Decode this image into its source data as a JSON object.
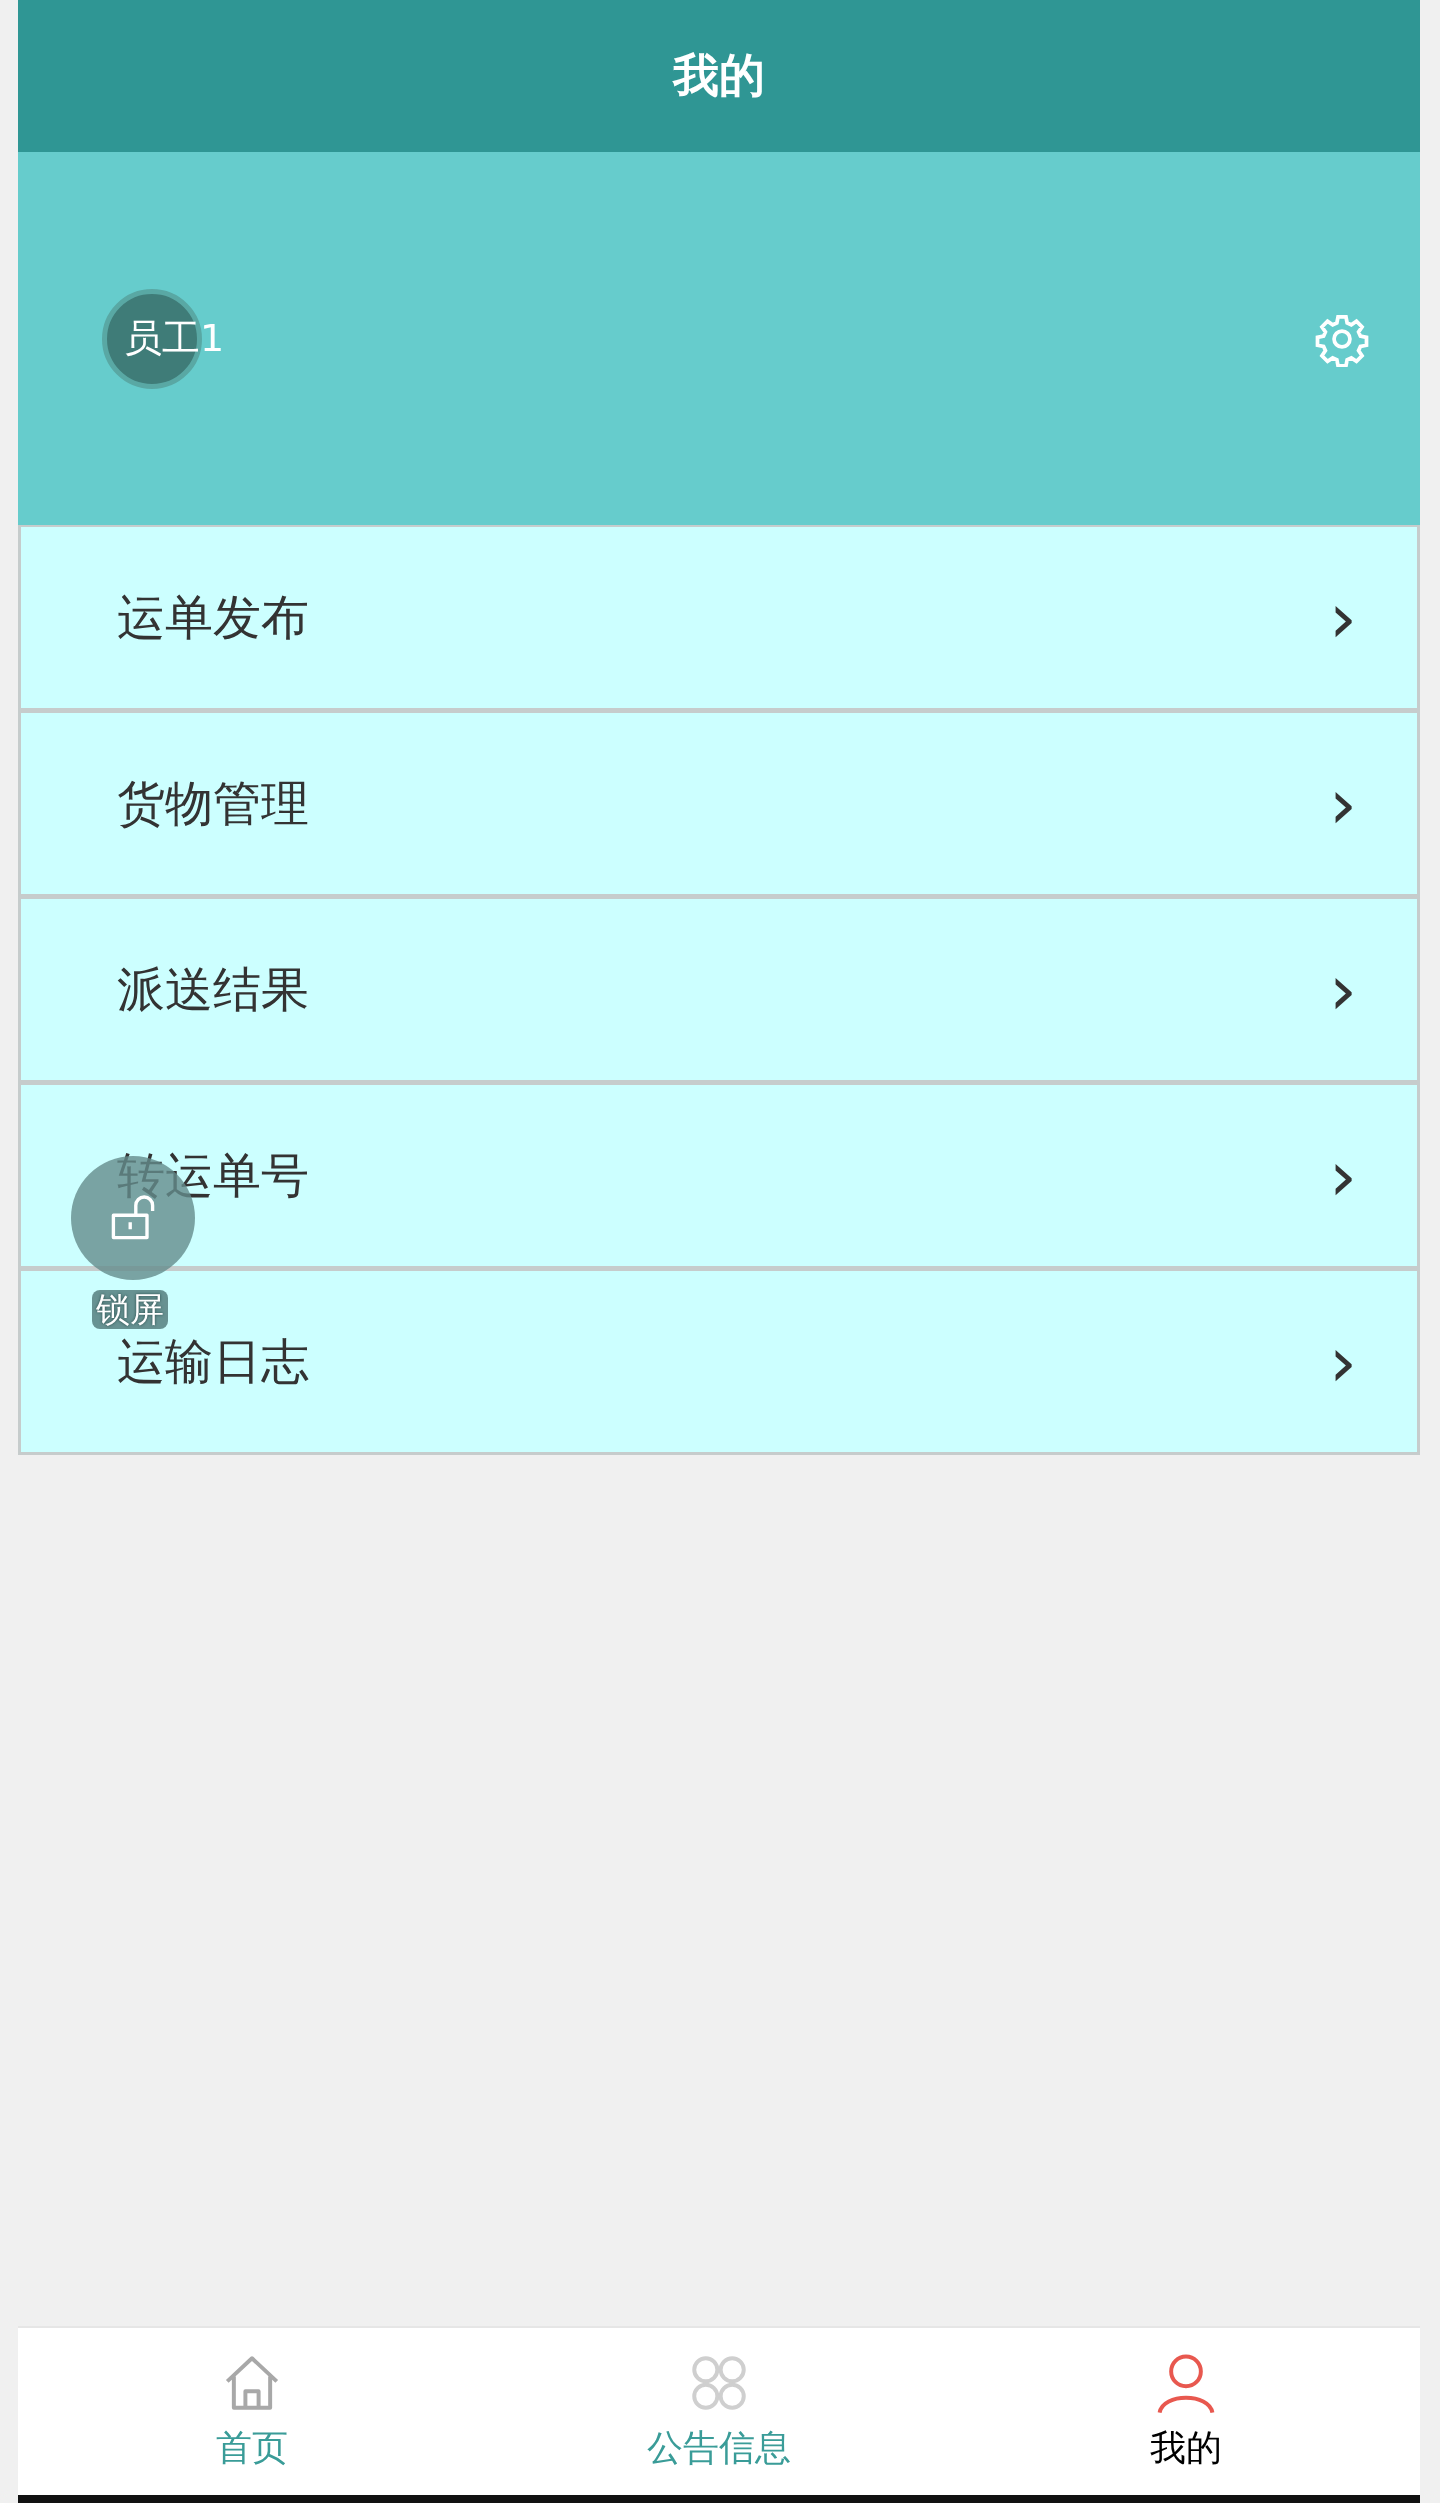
{
  "header": {
    "title": "我的"
  },
  "profile": {
    "name": "员工1"
  },
  "menu": [
    {
      "label": "运单发布",
      "chevron": "›"
    },
    {
      "label": "货物管理",
      "chevron": "›"
    },
    {
      "label": "派送结果",
      "chevron": "›"
    },
    {
      "label": "转运单号",
      "chevron": "›"
    },
    {
      "label": "运输日志",
      "chevron": "›"
    }
  ],
  "lock_button": {
    "label": "锁屏"
  },
  "tab_bar": [
    {
      "label": "首页",
      "kind": "home",
      "selected": false
    },
    {
      "label": "公告信息",
      "kind": "grid",
      "selected": false
    },
    {
      "label": "我的",
      "kind": "person",
      "selected": true
    }
  ]
}
